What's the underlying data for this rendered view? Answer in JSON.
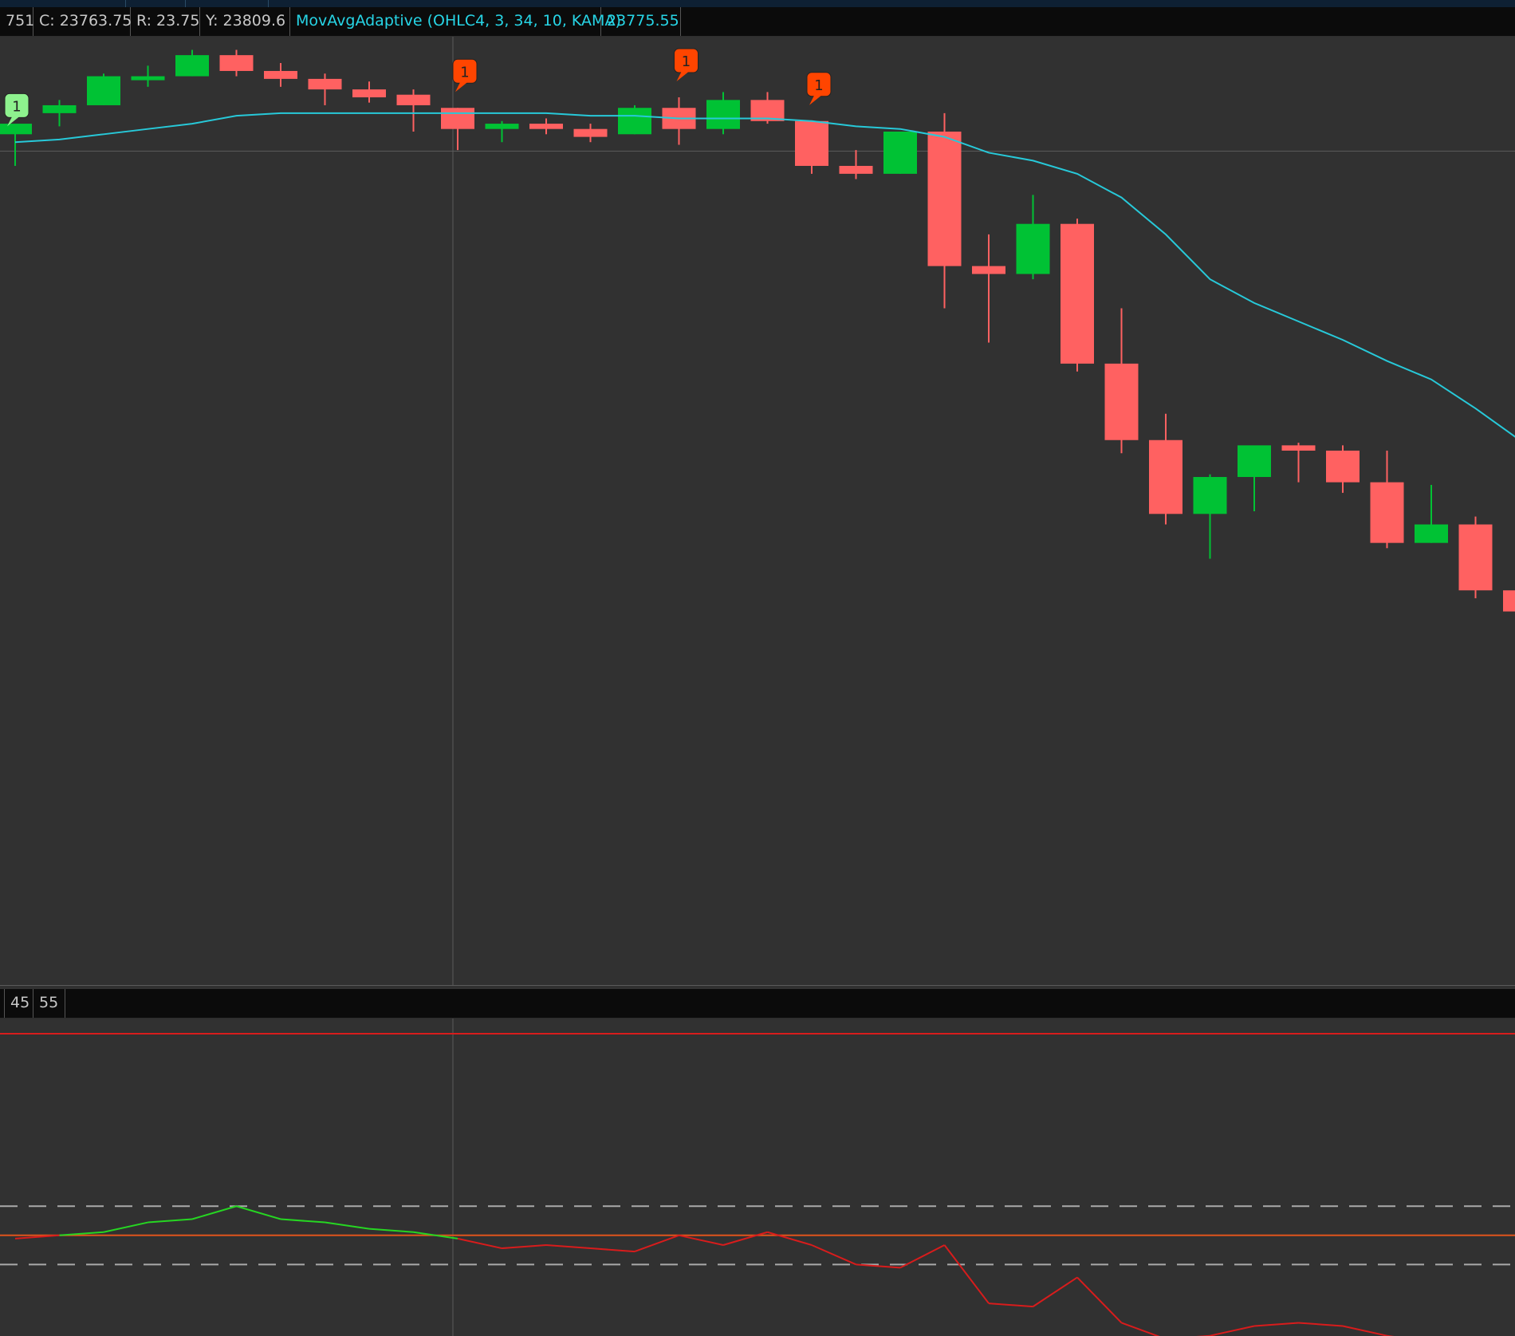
{
  "header": {
    "cells": [
      {
        "text": "751",
        "color": "gray"
      },
      {
        "text": "C: 23763.75",
        "color": "gray"
      },
      {
        "text": "R: 23.75",
        "color": "gray"
      },
      {
        "text": "Y: 23809.6",
        "color": "gray"
      },
      {
        "text": "MovAvgAdaptive (OHLC4, 3, 34, 10, KAMA)",
        "color": "cyan"
      },
      {
        "text": "23775.55",
        "color": "cyan"
      }
    ]
  },
  "lower_header": {
    "cells": [
      {
        "text": "45"
      },
      {
        "text": "55"
      }
    ]
  },
  "colors": {
    "up": "#00c234",
    "down": "#ff6161",
    "ma": "#27c9d9",
    "osc_up": "#26d622",
    "osc_down": "#d81c1c",
    "overbought": "#d81c1c",
    "zero": "#e0541c",
    "bands": "#aaaaaa",
    "background": "#313131",
    "signal_sell": "#ff4500",
    "signal_buy": "#8ef28e"
  },
  "chart_data": [
    {
      "type": "candlestick",
      "title": "",
      "indicator": "MovAvgAdaptive (OHLC4, 3, 34, 10, KAMA)",
      "indicator_value": 23775.55,
      "ylim": [
        23495,
        23855
      ],
      "bars": [
        {
          "i": 0,
          "o": 23818,
          "h": 23821,
          "l": 23806,
          "c": 23822
        },
        {
          "i": 1,
          "o": 23826,
          "h": 23831,
          "l": 23821,
          "c": 23829
        },
        {
          "i": 2,
          "o": 23829,
          "h": 23841,
          "l": 23829,
          "c": 23840
        },
        {
          "i": 3,
          "o": 23839,
          "h": 23844,
          "l": 23836,
          "c": 23840
        },
        {
          "i": 4,
          "o": 23840,
          "h": 23850,
          "l": 23840,
          "c": 23848
        },
        {
          "i": 5,
          "o": 23848,
          "h": 23850,
          "l": 23840,
          "c": 23842
        },
        {
          "i": 6,
          "o": 23842,
          "h": 23845,
          "l": 23836,
          "c": 23839
        },
        {
          "i": 7,
          "o": 23839,
          "h": 23841,
          "l": 23829,
          "c": 23835
        },
        {
          "i": 8,
          "o": 23835,
          "h": 23838,
          "l": 23830,
          "c": 23832
        },
        {
          "i": 9,
          "o": 23833,
          "h": 23835,
          "l": 23819,
          "c": 23829
        },
        {
          "i": 10,
          "o": 23828,
          "h": 23828,
          "l": 23812,
          "c": 23820
        },
        {
          "i": 11,
          "o": 23820,
          "h": 23823,
          "l": 23815,
          "c": 23822
        },
        {
          "i": 12,
          "o": 23822,
          "h": 23824,
          "l": 23818,
          "c": 23820
        },
        {
          "i": 13,
          "o": 23820,
          "h": 23822,
          "l": 23815,
          "c": 23817
        },
        {
          "i": 14,
          "o": 23818,
          "h": 23829,
          "l": 23818,
          "c": 23828
        },
        {
          "i": 15,
          "o": 23828,
          "h": 23832,
          "l": 23814,
          "c": 23820
        },
        {
          "i": 16,
          "o": 23820,
          "h": 23834,
          "l": 23818,
          "c": 23831
        },
        {
          "i": 17,
          "o": 23831,
          "h": 23834,
          "l": 23822,
          "c": 23823
        },
        {
          "i": 18,
          "o": 23823,
          "h": 23823,
          "l": 23803,
          "c": 23806
        },
        {
          "i": 19,
          "o": 23806,
          "h": 23812,
          "l": 23801,
          "c": 23803
        },
        {
          "i": 20,
          "o": 23803,
          "h": 23819,
          "l": 23803,
          "c": 23819
        },
        {
          "i": 21,
          "o": 23819,
          "h": 23826,
          "l": 23752,
          "c": 23768
        },
        {
          "i": 22,
          "o": 23768,
          "h": 23780,
          "l": 23739,
          "c": 23765
        },
        {
          "i": 23,
          "o": 23765,
          "h": 23795,
          "l": 23763,
          "c": 23784
        },
        {
          "i": 24,
          "o": 23784,
          "h": 23786,
          "l": 23728,
          "c": 23731
        },
        {
          "i": 25,
          "o": 23731,
          "h": 23752,
          "l": 23697,
          "c": 23702
        },
        {
          "i": 26,
          "o": 23702,
          "h": 23712,
          "l": 23670,
          "c": 23674
        },
        {
          "i": 27,
          "o": 23674,
          "h": 23689,
          "l": 23657,
          "c": 23688
        },
        {
          "i": 28,
          "o": 23688,
          "h": 23694,
          "l": 23675,
          "c": 23700
        },
        {
          "i": 29,
          "o": 23700,
          "h": 23701,
          "l": 23686,
          "c": 23698
        },
        {
          "i": 30,
          "o": 23698,
          "h": 23700,
          "l": 23682,
          "c": 23686
        },
        {
          "i": 31,
          "o": 23686,
          "h": 23698,
          "l": 23661,
          "c": 23663
        },
        {
          "i": 32,
          "o": 23663,
          "h": 23685,
          "l": 23663,
          "c": 23670
        },
        {
          "i": 33,
          "o": 23670,
          "h": 23673,
          "l": 23642,
          "c": 23645
        },
        {
          "i": 34,
          "o": 23645,
          "h": 23654,
          "l": 23637,
          "c": 23637
        }
      ],
      "ma": [
        23815,
        23816,
        23818,
        23820,
        23822,
        23825,
        23826,
        23826,
        23826,
        23826,
        23826,
        23826,
        23826,
        23825,
        23825,
        23824,
        23824,
        23824,
        23823,
        23821,
        23820,
        23817,
        23811,
        23808,
        23803,
        23794,
        23780,
        23763,
        23754,
        23747,
        23740,
        23732,
        23725,
        23714,
        23702
      ],
      "signals": [
        {
          "i": 0,
          "label": "1",
          "side": "buy"
        },
        {
          "i": 10,
          "label": "1",
          "side": "sell"
        },
        {
          "i": 15,
          "label": "1",
          "side": "sell"
        },
        {
          "i": 18,
          "label": "1",
          "side": "sell"
        }
      ]
    },
    {
      "type": "line",
      "title": "",
      "levels": [
        45,
        55
      ],
      "ylim": [
        -36,
        62
      ],
      "overbought_level": 62,
      "zero_level": 0,
      "upper_band": 9,
      "lower_band": -9,
      "series": [
        {
          "values": [
            -1,
            0,
            1,
            4,
            5,
            9,
            5,
            4,
            2,
            1,
            -1,
            -4,
            -3,
            -4,
            -5,
            0,
            -3,
            1,
            -3,
            -9,
            -10,
            -3,
            -21,
            -22,
            -13,
            -27,
            -32,
            -31,
            -28,
            -27,
            -28,
            -31,
            -33,
            -35,
            -35
          ]
        }
      ]
    }
  ]
}
